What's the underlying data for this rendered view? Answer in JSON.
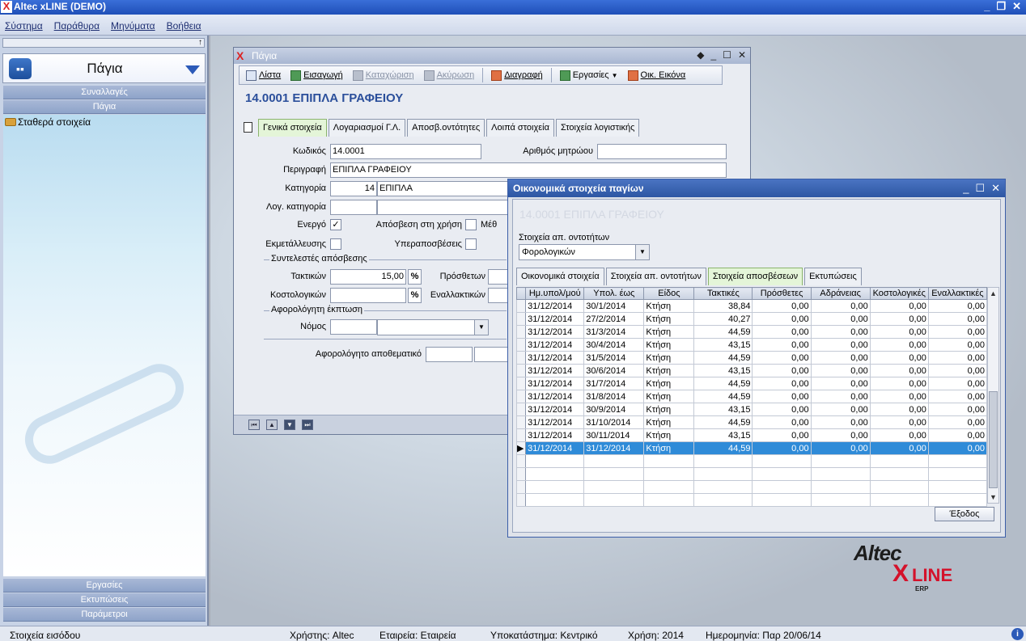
{
  "app": {
    "title": "Altec xLINE (DEMO)",
    "logo": "X",
    "window_buttons": [
      "_",
      "❐",
      "✕"
    ]
  },
  "menu": [
    "Σύστημα",
    "Παράθυρα",
    "Μηνύματα",
    "Βοήθεια"
  ],
  "sidebar": {
    "pin": "↑",
    "header": "Πάγια",
    "sections_top": [
      "Συναλλαγές",
      "Πάγια"
    ],
    "tree_item": "Σταθερά στοιχεία",
    "sections_bottom": [
      "Εργασίες",
      "Εκτυπώσεις",
      "Παράμετροι"
    ]
  },
  "assets_window": {
    "title": "Πάγια",
    "title_buttons": [
      "◆",
      "_",
      "☐",
      "✕"
    ],
    "toolbar": {
      "list": "Λίστα",
      "import": "Εισαγωγή",
      "register": "Καταχώριση",
      "cancel": "Ακύρωση",
      "delete": "Διαγραφή",
      "tasks": "Εργασίες",
      "tasks_arrow": "▼",
      "image": "Οικ. Εικόνα"
    },
    "record_title": "14.0001 ΕΠΙΠΛΑ ΓΡΑΦΕΙΟΥ",
    "tabs": [
      "Γενικά στοιχεία",
      "Λογαριασμοί Γ.Λ.",
      "Αποσβ.οντότητες",
      "Λοιπά στοιχεία",
      "Στοιχεία λογιστικής"
    ],
    "form": {
      "code_label": "Κωδικός",
      "code_value": "14.0001",
      "registry_label": "Αριθμός μητρώου",
      "registry_value": "",
      "desc_label": "Περιγραφή",
      "desc_value": "ΕΠΙΠΛΑ ΓΡΑΦΕΙΟΥ",
      "category_label": "Κατηγορία",
      "category_code": "14",
      "category_name": "ΕΠΙΠΛΑ",
      "acc_category_label": "Λογ. κατηγορία",
      "active_label": "Ενεργό",
      "active_mark": "✓",
      "dep_use_label": "Απόσβεση στη χρήση",
      "method_label": "Μέθ",
      "exploit_label": "Εκμετάλλευσης",
      "overdep_label": "Υπεραποσβέσεις",
      "coef_group": "Συντελεστές απόσβεσης",
      "regular_label": "Τακτικών",
      "regular_value": "15,00",
      "pct": "%",
      "additional_label": "Πρόσθετων",
      "cost_label": "Κοστολογικών",
      "alternative_label": "Εναλλακτικών",
      "taxfree_group": "Αφορολόγητη έκπτωση",
      "law_label": "Νόμος",
      "reserve_label": "Αφορολόγητο αποθεματικό"
    },
    "nav_buttons": [
      "⏮",
      "▲",
      "▼",
      "⏭"
    ]
  },
  "econ_window": {
    "title": "Οικονομικά στοιχεία παγίων",
    "title_buttons": [
      "_",
      "☐",
      "✕"
    ],
    "ghost_title": "14.0001 ΕΠΙΠΛΑ ΓΡΑΦΕΙΟΥ",
    "entity_label": "Στοιχεία απ. οντοτήτων",
    "entity_value": "Φορολογικών",
    "tabs": [
      "Οικονομικά στοιχεία",
      "Στοιχεία απ. οντοτήτων",
      "Στοιχεία αποσβέσεων",
      "Εκτυπώσεις"
    ],
    "columns": [
      "Ημ.υπολ/μού",
      "Υπολ. έως",
      "Είδος",
      "Τακτικές",
      "Πρόσθετες",
      "Αδράνειας",
      "Κοστολογικές",
      "Εναλλακτικές"
    ],
    "rows": [
      [
        "31/12/2014",
        "30/1/2014",
        "Κτήση",
        "38,84",
        "0,00",
        "0,00",
        "0,00",
        "0,00"
      ],
      [
        "31/12/2014",
        "27/2/2014",
        "Κτήση",
        "40,27",
        "0,00",
        "0,00",
        "0,00",
        "0,00"
      ],
      [
        "31/12/2014",
        "31/3/2014",
        "Κτήση",
        "44,59",
        "0,00",
        "0,00",
        "0,00",
        "0,00"
      ],
      [
        "31/12/2014",
        "30/4/2014",
        "Κτήση",
        "43,15",
        "0,00",
        "0,00",
        "0,00",
        "0,00"
      ],
      [
        "31/12/2014",
        "31/5/2014",
        "Κτήση",
        "44,59",
        "0,00",
        "0,00",
        "0,00",
        "0,00"
      ],
      [
        "31/12/2014",
        "30/6/2014",
        "Κτήση",
        "43,15",
        "0,00",
        "0,00",
        "0,00",
        "0,00"
      ],
      [
        "31/12/2014",
        "31/7/2014",
        "Κτήση",
        "44,59",
        "0,00",
        "0,00",
        "0,00",
        "0,00"
      ],
      [
        "31/12/2014",
        "31/8/2014",
        "Κτήση",
        "44,59",
        "0,00",
        "0,00",
        "0,00",
        "0,00"
      ],
      [
        "31/12/2014",
        "30/9/2014",
        "Κτήση",
        "43,15",
        "0,00",
        "0,00",
        "0,00",
        "0,00"
      ],
      [
        "31/12/2014",
        "31/10/2014",
        "Κτήση",
        "44,59",
        "0,00",
        "0,00",
        "0,00",
        "0,00"
      ],
      [
        "31/12/2014",
        "30/11/2014",
        "Κτήση",
        "43,15",
        "0,00",
        "0,00",
        "0,00",
        "0,00"
      ],
      [
        "31/12/2014",
        "31/12/2014",
        "Κτήση",
        "44,59",
        "0,00",
        "0,00",
        "0,00",
        "0,00"
      ]
    ],
    "selected_row": 11,
    "row_marker": "▶",
    "scroll_up": "▲",
    "scroll_down": "▼",
    "exit_button": "Έξοδος"
  },
  "brand": {
    "altec": "Altec",
    "x": "X",
    "line": "LINE",
    "erp": "ERP"
  },
  "status": {
    "input": "Στοιχεία εισόδου",
    "user": "Χρήστης: Altec",
    "company": "Εταιρεία: Εταιρεία",
    "branch": "Υποκατάστημα: Κεντρικό",
    "year": "Χρήση: 2014",
    "date": "Ημερομηνία: Παρ 20/06/14",
    "info": "i"
  },
  "colors": {
    "accent": "#2c5ab8",
    "selected_row": "#2f8bd8",
    "record_title": "#2b4f9b",
    "brand_red": "#d4122b"
  }
}
